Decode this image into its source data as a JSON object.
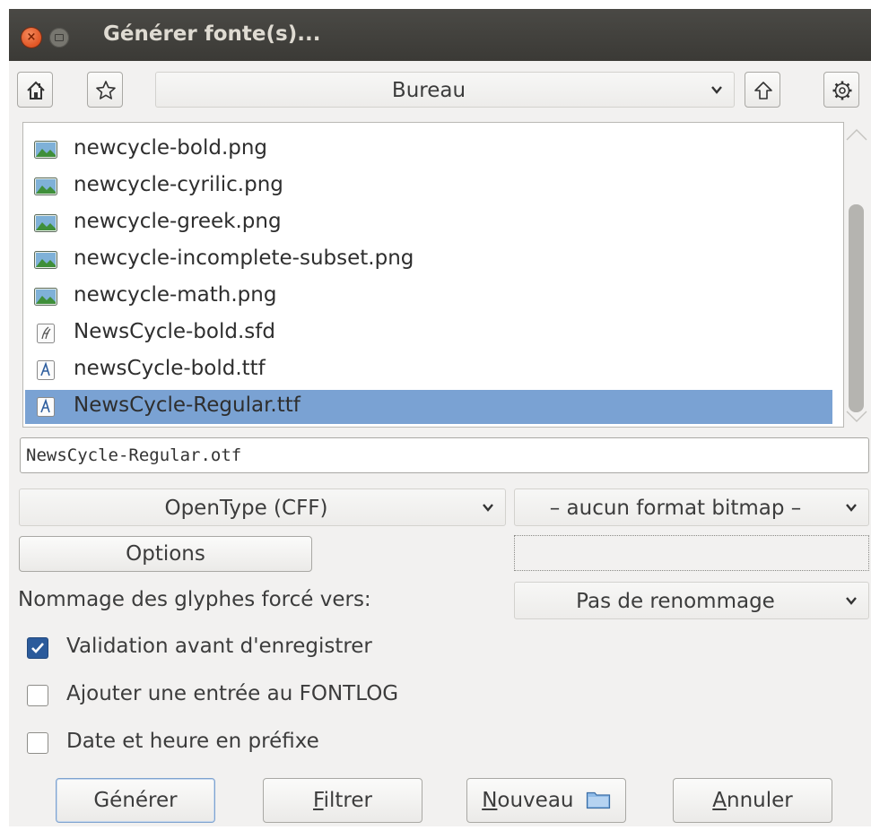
{
  "window": {
    "title": "Générer fonte(s)..."
  },
  "toolbar": {
    "location": "Bureau"
  },
  "files": [
    {
      "name": "newcycle-bold.png",
      "type": "image"
    },
    {
      "name": "newcycle-cyrilic.png",
      "type": "image"
    },
    {
      "name": "newcycle-greek.png",
      "type": "image"
    },
    {
      "name": "newcycle-incomplete-subset.png",
      "type": "image"
    },
    {
      "name": "newcycle-math.png",
      "type": "image"
    },
    {
      "name": "NewsCycle-bold.sfd",
      "type": "sfd"
    },
    {
      "name": "newsCycle-bold.ttf",
      "type": "font"
    },
    {
      "name": "NewsCycle-Regular.ttf",
      "type": "font",
      "selected": true
    }
  ],
  "filename_field": "NewsCycle-Regular.otf",
  "format_select": "OpenType (CFF)",
  "bitmap_select": "– aucun format bitmap –",
  "options_button": "Options",
  "glyph_naming": {
    "label": "Nommage des glyphes forcé vers:",
    "value": "Pas de renommage"
  },
  "checkboxes": [
    {
      "label": "Validation avant d'enregistrer",
      "checked": true
    },
    {
      "label": "Ajouter une entrée au FONTLOG",
      "checked": false
    },
    {
      "label": "Date et heure en préfixe",
      "checked": false
    }
  ],
  "buttons": {
    "generate": "Générer",
    "filter_mnemonic": "F",
    "filter_rest": "iltrer",
    "new_mnemonic": "N",
    "new_rest": "ouveau",
    "cancel_mnemonic": "A",
    "cancel_rest": "nnuler"
  },
  "colors": {
    "selection": "#7aa2d3",
    "checkbox_checked": "#2c5b9b",
    "titlebar": "#3c3b37",
    "close_button": "#e95420"
  }
}
